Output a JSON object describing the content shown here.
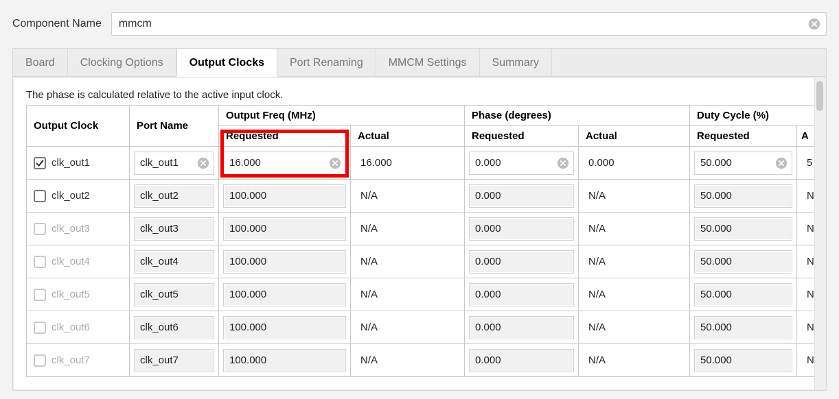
{
  "component": {
    "label": "Component Name",
    "value": "mmcm"
  },
  "tabs": [
    "Board",
    "Clocking Options",
    "Output Clocks",
    "Port Renaming",
    "MMCM Settings",
    "Summary"
  ],
  "active_tab": 2,
  "note": "The phase is calculated relative to the active input clock.",
  "headers": {
    "output_clock": "Output Clock",
    "port_name": "Port Name",
    "output_freq": "Output Freq (MHz)",
    "phase": "Phase (degrees)",
    "duty": "Duty Cycle (%)",
    "requested": "Requested",
    "actual": "Actual",
    "actual_short": "A"
  },
  "rows": [
    {
      "enabled": true,
      "checked": true,
      "name": "clk_out1",
      "port": "clk_out1",
      "freq_req": "16.000",
      "freq_act": "16.000",
      "phase_req": "0.000",
      "phase_act": "0.000",
      "duty_req": "50.000",
      "duty_act": "5",
      "active": true
    },
    {
      "enabled": true,
      "checked": false,
      "name": "clk_out2",
      "port": "clk_out2",
      "freq_req": "100.000",
      "freq_act": "N/A",
      "phase_req": "0.000",
      "phase_act": "N/A",
      "duty_req": "50.000",
      "duty_act": "N",
      "active": false
    },
    {
      "enabled": false,
      "checked": false,
      "name": "clk_out3",
      "port": "clk_out3",
      "freq_req": "100.000",
      "freq_act": "N/A",
      "phase_req": "0.000",
      "phase_act": "N/A",
      "duty_req": "50.000",
      "duty_act": "N",
      "active": false
    },
    {
      "enabled": false,
      "checked": false,
      "name": "clk_out4",
      "port": "clk_out4",
      "freq_req": "100.000",
      "freq_act": "N/A",
      "phase_req": "0.000",
      "phase_act": "N/A",
      "duty_req": "50.000",
      "duty_act": "N",
      "active": false
    },
    {
      "enabled": false,
      "checked": false,
      "name": "clk_out5",
      "port": "clk_out5",
      "freq_req": "100.000",
      "freq_act": "N/A",
      "phase_req": "0.000",
      "phase_act": "N/A",
      "duty_req": "50.000",
      "duty_act": "N",
      "active": false
    },
    {
      "enabled": false,
      "checked": false,
      "name": "clk_out6",
      "port": "clk_out6",
      "freq_req": "100.000",
      "freq_act": "N/A",
      "phase_req": "0.000",
      "phase_act": "N/A",
      "duty_req": "50.000",
      "duty_act": "N",
      "active": false
    },
    {
      "enabled": false,
      "checked": false,
      "name": "clk_out7",
      "port": "clk_out7",
      "freq_req": "100.000",
      "freq_act": "N/A",
      "phase_req": "0.000",
      "phase_act": "N/A",
      "duty_req": "50.000",
      "duty_act": "N",
      "active": false
    }
  ]
}
